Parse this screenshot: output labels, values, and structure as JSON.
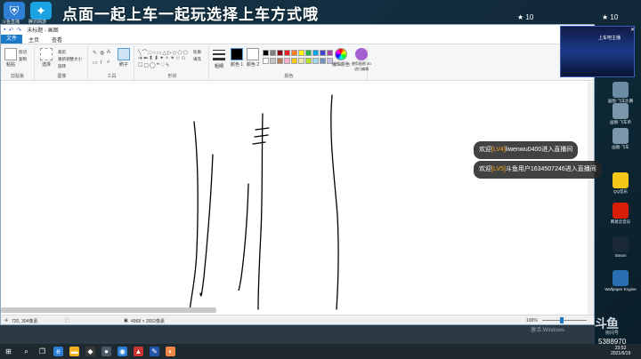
{
  "banner": {
    "title": "点面一起上车一起玩选择上车方式哦"
  },
  "top_icons": [
    {
      "label": "斗鱼直播",
      "icon": "shield-app-icon"
    },
    {
      "label": "腾讯网游",
      "icon": "bird-app-icon"
    }
  ],
  "overlay": {
    "viewers": "10",
    "gift_text": "10"
  },
  "paint": {
    "title": "未标题 - 画图",
    "tabs": {
      "file": "文件",
      "home": "主页",
      "view": "查看"
    },
    "groups": {
      "clipboard": "剪贴板",
      "image": "图像",
      "tools": "工具",
      "shapes": "形状",
      "colors": "颜色"
    },
    "ribbon_items": {
      "paste": "粘贴",
      "cut": "剪切",
      "copy": "复制",
      "select": "选择",
      "crop": "裁剪",
      "resize": "重新调整大小",
      "rotate": "旋转",
      "brush": "刷子",
      "outline": "轮廓",
      "fill": "填充",
      "size": "粗细",
      "color1": "颜色 1",
      "color2": "颜色 2",
      "edit_colors": "编辑颜色",
      "paint3d": "使用画图 3D 进行编辑"
    },
    "palette": [
      "#000000",
      "#7f7f7f",
      "#880015",
      "#ed1c24",
      "#ff7f27",
      "#fff200",
      "#22b14c",
      "#00a2e8",
      "#3f48cc",
      "#a349a4",
      "#ffffff",
      "#c3c3c3",
      "#b97a57",
      "#ffaec9",
      "#ffc90e",
      "#efe4b0",
      "#b5e61d",
      "#99d9ea",
      "#7092be",
      "#c8bfe7"
    ],
    "status": {
      "cursor": "720, 304像素",
      "canvas_size": "4968 × 2652像素",
      "zoom": "100%"
    }
  },
  "toasts": [
    {
      "prefix": "欢迎",
      "level": "[LV4]",
      "user": "liwenwu0400",
      "suffix": "进入直播间"
    },
    {
      "prefix": "欢迎",
      "level": "[LV5]",
      "user": "斗鱼用户1634507246",
      "suffix": "进入直播间"
    }
  ],
  "promo": {
    "text": "上车吧主播"
  },
  "desktop_icons": [
    {
      "label": "画图-飞车比赛",
      "icon": "paint-doc-icon",
      "color": "#6b8aa3"
    },
    {
      "label": "画图-飞车单",
      "icon": "paint-doc-icon",
      "color": "#7b95aa"
    },
    {
      "label": "画图-飞车",
      "icon": "paint-doc-icon",
      "color": "#7b95aa"
    },
    {
      "label": "QQ音乐",
      "icon": "qq-music-icon",
      "color": "#f5c518"
    },
    {
      "label": "网易云音乐",
      "icon": "netease-music-icon",
      "color": "#d81e06"
    },
    {
      "label": "Steam",
      "icon": "steam-icon",
      "color": "#1b2838"
    },
    {
      "label": "Wallpaper Engine",
      "icon": "wallpaper-engine-icon",
      "color": "#2a6fb3"
    }
  ],
  "douyu": {
    "logo": "斗鱼",
    "sub": "房间号",
    "room": "5388970"
  },
  "taskbar": {
    "time": "23:52",
    "date": "2021/6/19"
  },
  "watermark": "激活 Windows"
}
